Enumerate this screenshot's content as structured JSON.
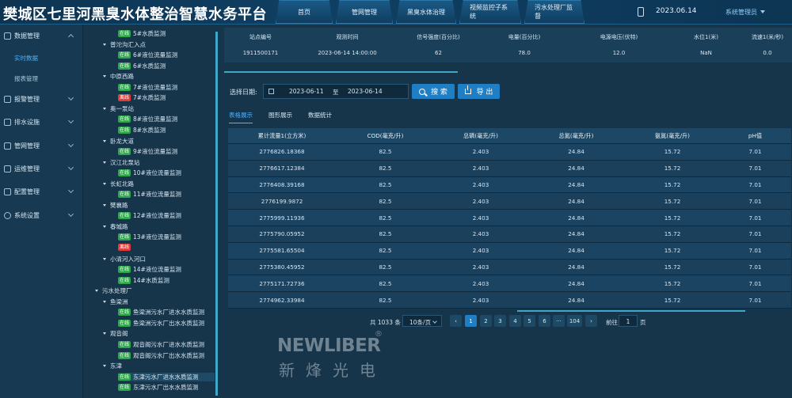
{
  "header": {
    "title": "樊城区七里河黑臭水体整治智慧水务平台",
    "nav": [
      "首页",
      "管网管理",
      "黑臭水体治理",
      "视频监控子系统",
      "污水处理厂监督"
    ],
    "date": "2023.06.14",
    "user": "系统管理员"
  },
  "leftmenu": {
    "items": [
      "数据管理",
      "报警管理",
      "排水设施",
      "管网管理",
      "运维管理",
      "配置管理",
      "系统设置"
    ],
    "sub": [
      "实时数据",
      "报表管理"
    ]
  },
  "tree": {
    "nodes": [
      {
        "type": "leaf",
        "badge": "在线",
        "badge_type": "on",
        "label": "5#水质监测"
      },
      {
        "type": "group",
        "label": "普沱沟汇入点"
      },
      {
        "type": "leaf",
        "badge": "在线",
        "badge_type": "on",
        "label": "6#液位流量监测"
      },
      {
        "type": "leaf",
        "badge": "在线",
        "badge_type": "on",
        "label": "6#水质监测"
      },
      {
        "type": "group",
        "label": "中原西路"
      },
      {
        "type": "leaf",
        "badge": "在线",
        "badge_type": "on",
        "label": "7#液位流量监测"
      },
      {
        "type": "leaf",
        "badge": "离线",
        "badge_type": "off",
        "label": "7#水质监测"
      },
      {
        "type": "group",
        "label": "奥一泵站"
      },
      {
        "type": "leaf",
        "badge": "在线",
        "badge_type": "on",
        "label": "8#液位流量监测"
      },
      {
        "type": "leaf",
        "badge": "在线",
        "badge_type": "on",
        "label": "8#水质监测"
      },
      {
        "type": "group",
        "label": "卧龙大道"
      },
      {
        "type": "leaf",
        "badge": "在线",
        "badge_type": "on",
        "label": "9#液位流量监测"
      },
      {
        "type": "group",
        "label": "汉江北泵站"
      },
      {
        "type": "leaf",
        "badge": "在线",
        "badge_type": "on",
        "label": "10#液位流量监测"
      },
      {
        "type": "group",
        "label": "长虹北路"
      },
      {
        "type": "leaf",
        "badge": "在线",
        "badge_type": "on",
        "label": "11#液位流量监测"
      },
      {
        "type": "group",
        "label": "樊襄路"
      },
      {
        "type": "leaf",
        "badge": "在线",
        "badge_type": "on",
        "label": "12#液位流量监测"
      },
      {
        "type": "group",
        "label": "春城路"
      },
      {
        "type": "leaf",
        "badge": "在线",
        "badge_type": "on",
        "label": "13#液位流量监测"
      },
      {
        "type": "leaf",
        "badge": "离线",
        "badge_type": "off",
        "label": ""
      },
      {
        "type": "group",
        "label": "小清河入河口"
      },
      {
        "type": "leaf",
        "badge": "在线",
        "badge_type": "on",
        "label": "14#液位流量监测"
      },
      {
        "type": "leaf",
        "badge": "在线",
        "badge_type": "on",
        "label": "14#水质监测"
      },
      {
        "type": "group0",
        "label": "污水处理厂"
      },
      {
        "type": "group",
        "label": "鱼梁洲"
      },
      {
        "type": "leaf",
        "badge": "在线",
        "badge_type": "on",
        "label": "鱼梁洲污水厂进水水质监测"
      },
      {
        "type": "leaf",
        "badge": "在线",
        "badge_type": "on",
        "label": "鱼梁洲污水厂出水水质监测"
      },
      {
        "type": "group",
        "label": "观音阁"
      },
      {
        "type": "leaf",
        "badge": "在线",
        "badge_type": "on",
        "label": "观音阁污水厂进水水质监测"
      },
      {
        "type": "leaf",
        "badge": "在线",
        "badge_type": "on",
        "label": "观音阁污水厂出水水质监测"
      },
      {
        "type": "group",
        "label": "东津"
      },
      {
        "type": "leaf",
        "badge": "在线",
        "badge_type": "on",
        "label": "东津污水厂进水水质监测",
        "selected": true
      },
      {
        "type": "leaf",
        "badge": "在线",
        "badge_type": "on",
        "label": "东津污水厂出水水质监测"
      }
    ]
  },
  "station": {
    "headers": [
      "站点编号",
      "观测时间",
      "信号强度(百分比)",
      "电量(百分比)",
      "电源电压(伏特)",
      "水位1(米)",
      "流速1(米/秒)"
    ],
    "values": [
      "1911500171",
      "2023-06-14 14:00:00",
      "62",
      "78.0",
      "12.0",
      "NaN",
      "0.0"
    ]
  },
  "filter": {
    "label": "选择日期:",
    "start": "2023-06-11",
    "to": "至",
    "end": "2023-06-14",
    "search": "搜 索",
    "export": "导 出"
  },
  "tabs": [
    "表格展示",
    "图形展示",
    "数据统计"
  ],
  "table": {
    "headers": [
      "累计流量1(立方米)",
      "COD(毫克/升)",
      "总磷(毫克/升)",
      "总氮(毫克/升)",
      "氨氮(毫克/升)",
      "pH值"
    ],
    "rows": [
      [
        "2776826.18368",
        "82.5",
        "2.403",
        "24.84",
        "15.72",
        "7.01"
      ],
      [
        "2776617.12384",
        "82.5",
        "2.403",
        "24.84",
        "15.72",
        "7.01"
      ],
      [
        "2776408.39168",
        "82.5",
        "2.403",
        "24.84",
        "15.72",
        "7.01"
      ],
      [
        "2776199.9872",
        "82.5",
        "2.403",
        "24.84",
        "15.72",
        "7.01"
      ],
      [
        "2775999.11936",
        "82.5",
        "2.403",
        "24.84",
        "15.72",
        "7.01"
      ],
      [
        "2775790.05952",
        "82.5",
        "2.403",
        "24.84",
        "15.72",
        "7.01"
      ],
      [
        "2775581.65504",
        "82.5",
        "2.403",
        "24.84",
        "15.72",
        "7.01"
      ],
      [
        "2775380.45952",
        "82.5",
        "2.403",
        "24.84",
        "15.72",
        "7.01"
      ],
      [
        "2775171.72736",
        "82.5",
        "2.403",
        "24.84",
        "15.72",
        "7.01"
      ],
      [
        "2774962.33984",
        "82.5",
        "2.403",
        "24.84",
        "15.72",
        "7.01"
      ]
    ]
  },
  "pagination": {
    "total": "共 1033 条",
    "pagesize": "10条/页",
    "prev": "‹",
    "pages": [
      "1",
      "2",
      "3",
      "4",
      "5",
      "6",
      "···",
      "104"
    ],
    "next": "›",
    "goto": "前往",
    "goto_value": "1",
    "unit": "页"
  },
  "watermark": {
    "logo": "NEWLIBER",
    "reg": "®",
    "cn": "新烽光电"
  }
}
